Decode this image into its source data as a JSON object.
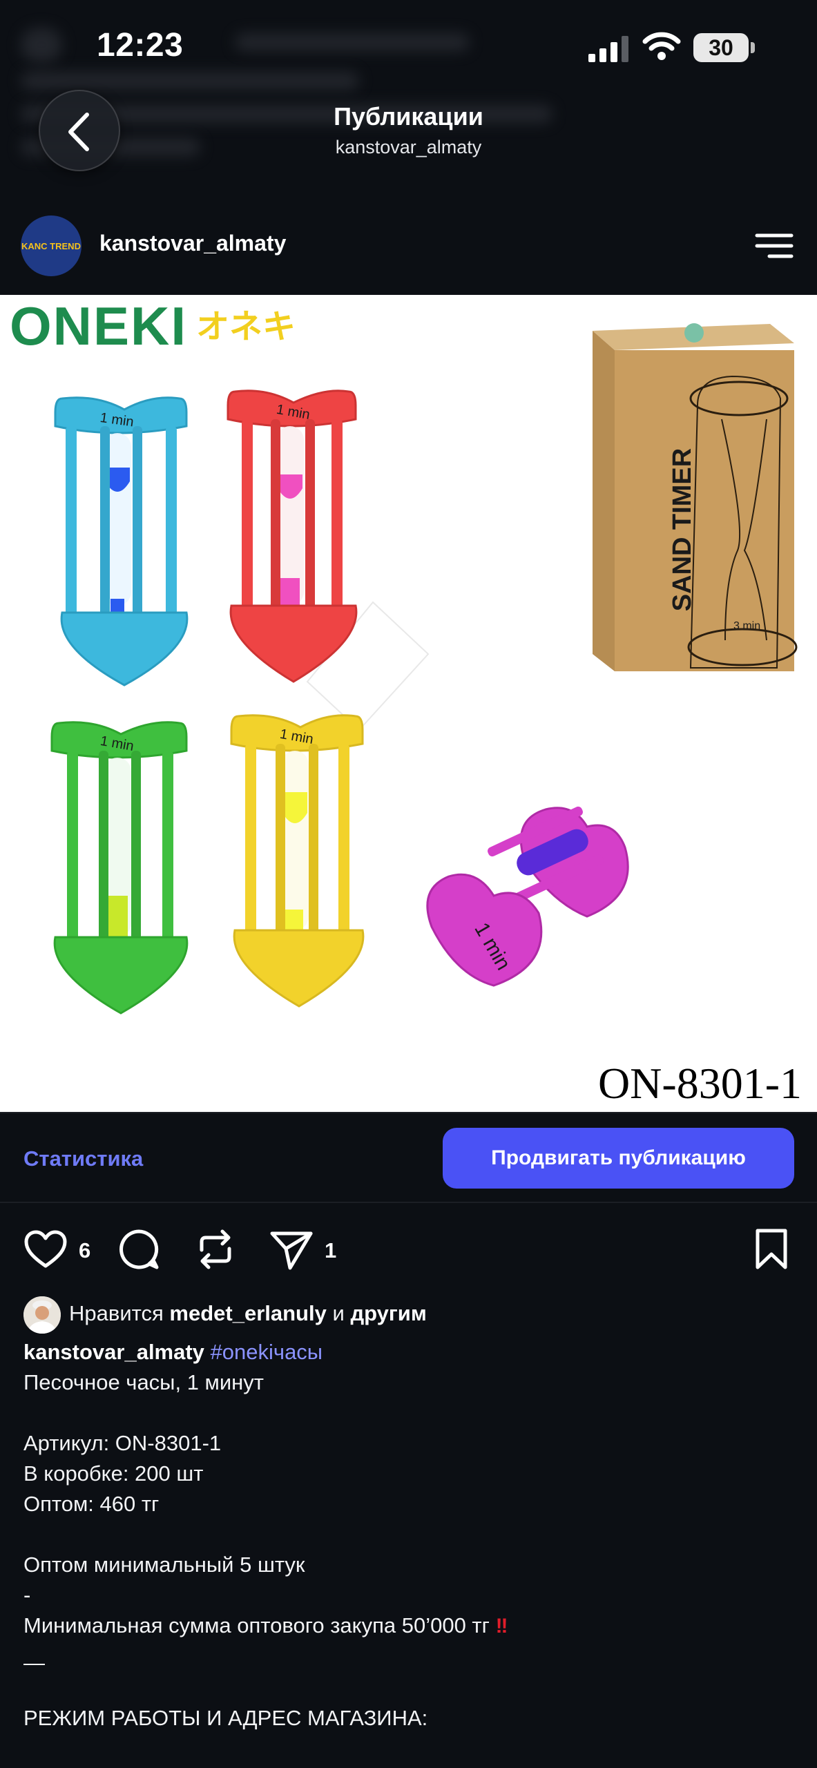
{
  "status_bar": {
    "time": "12:23",
    "battery": "30"
  },
  "header": {
    "title": "Публикации",
    "subtitle": "kanstovar_almaty"
  },
  "author": {
    "name": "kanstovar_almaty",
    "avatar_text": "KANC TREND"
  },
  "image": {
    "brand": "ONEKI",
    "brand_jp": "オネキ",
    "product_code": "ON-8301-1",
    "box_text": "SAND TIMER",
    "box_small": "3 min",
    "timer_label": "1 min",
    "timer_colors": [
      "#3db8dd",
      "#ee4444",
      "#3fbf3f",
      "#f2d22b",
      "#d53fc9"
    ],
    "sand_colors": [
      "#2b5bf0",
      "#f050c0",
      "#c8e82a",
      "#f5f53a",
      "#5a2bd8"
    ]
  },
  "actions": {
    "stats_label": "Статистика",
    "promote_label": "Продвигать публикацию",
    "like_count": "6",
    "share_count": "1"
  },
  "likes": {
    "prefix": "Нравится",
    "user": "medet_erlanuly",
    "middle": "и",
    "suffix": "другим"
  },
  "caption": {
    "author": "kanstovar_almaty",
    "hashtag": "#onekiчасы",
    "lines": [
      "Песочное часы, 1 минут",
      "",
      "Артикул: ON-8301-1",
      "В коробке: 200 шт",
      "Оптом: 460 тг",
      "",
      "Оптом минимальный 5 штук",
      "-",
      "Минимальная сумма оптового закупа 50’000 тг",
      "—",
      "",
      "РЕЖИМ РАБОТЫ И АДРЕС МАГАЗИНА:"
    ],
    "alert_emoji": "!!"
  },
  "colors": {
    "accent": "#4a52f5",
    "link": "#6f7bf7",
    "hashtag": "#8b93ff",
    "background": "#0c0f14"
  }
}
